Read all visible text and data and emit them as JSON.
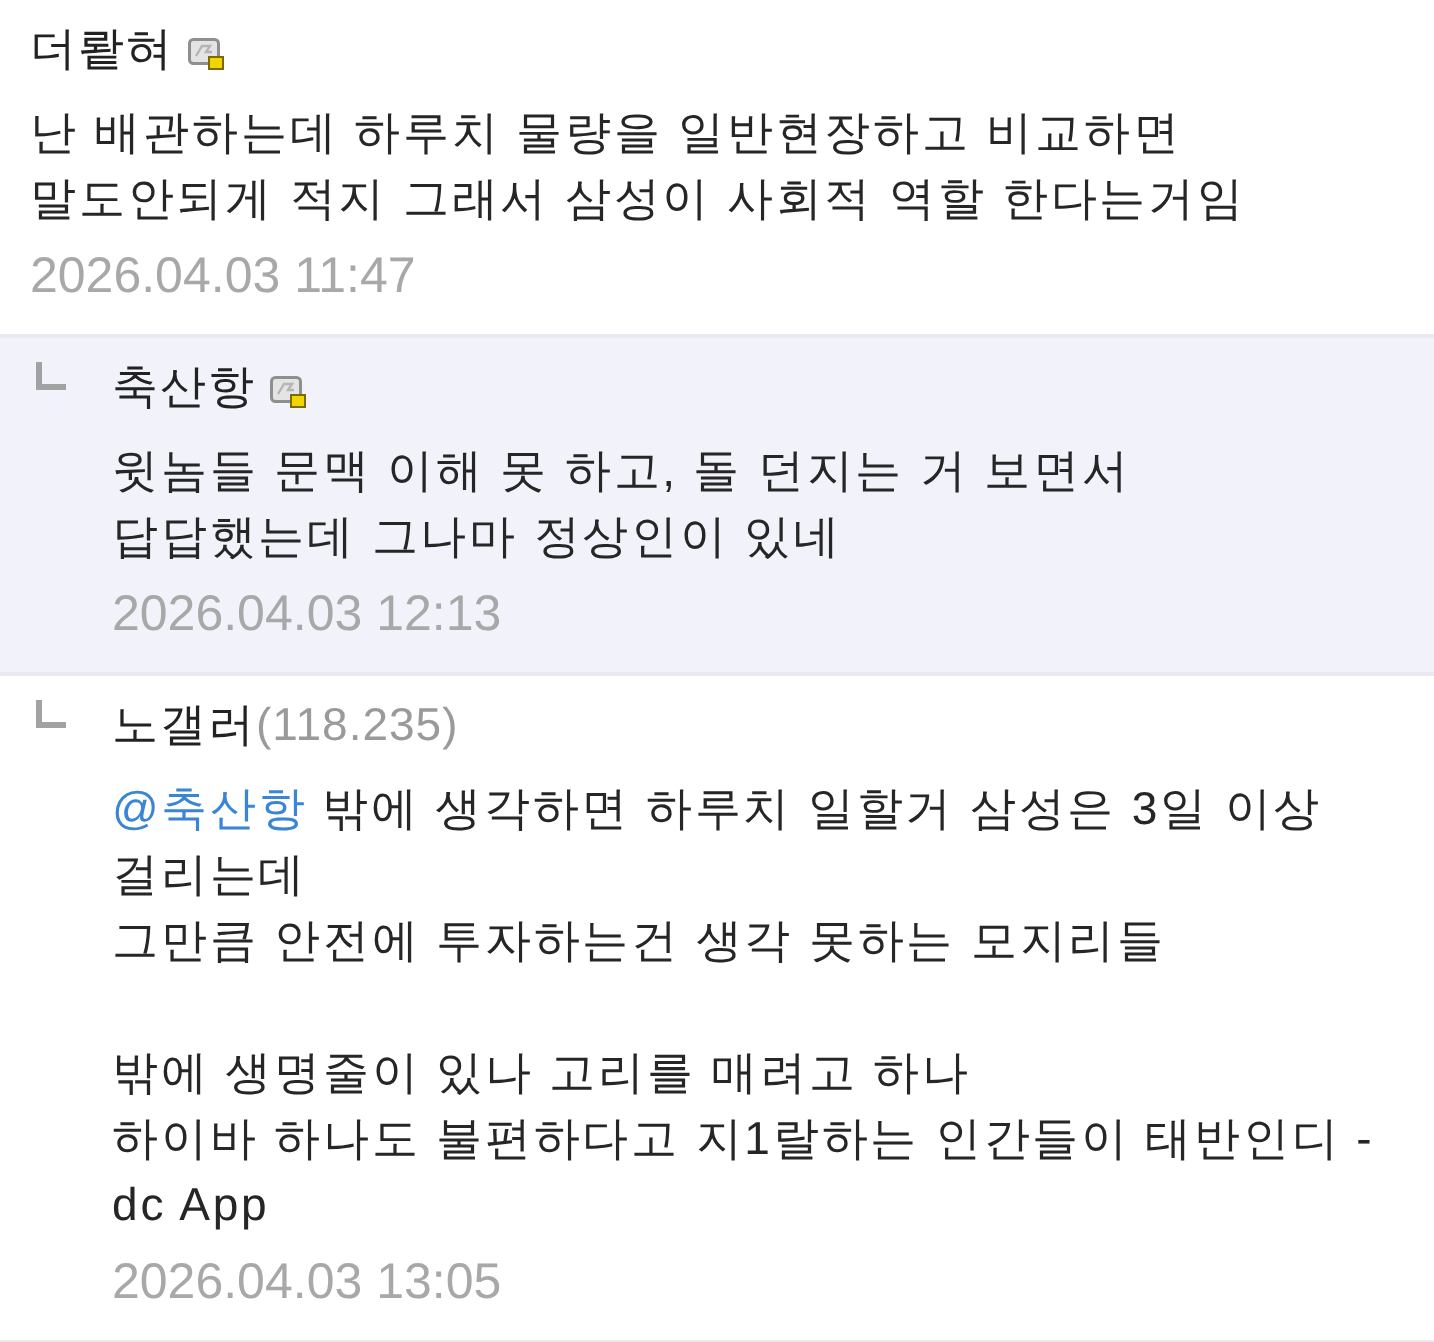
{
  "comments": [
    {
      "reply": false,
      "highlighted": false,
      "author": "더뢑혀",
      "kind": "member",
      "paragraphs": [
        {
          "lines": [
            "난 배관하는데 하루치 물량을 일반현장하고 비교하면",
            "말도안되게 적지 그래서 삼성이 사회적 역할 한다는거임"
          ]
        }
      ],
      "date": "2026.04.03 11:47"
    },
    {
      "reply": true,
      "highlighted": true,
      "author": "축산항",
      "kind": "member",
      "paragraphs": [
        {
          "lines": [
            "윗놈들 문맥 이해 못 하고, 돌 던지는 거 보면서",
            "답답했는데 그나마 정상인이 있네"
          ]
        }
      ],
      "date": "2026.04.03 12:13"
    },
    {
      "reply": true,
      "highlighted": false,
      "author": "노갤러",
      "kind": "guest",
      "ip": "(118.235)",
      "paragraphs": [
        {
          "mention": "@축산항",
          "lines": [
            "밖에 생각하면 하루치 일할거 삼성은 3일 이상",
            "걸리는데",
            "그만큼 안전에 투자하는건 생각 못하는 모지리들"
          ]
        },
        {
          "lines": [
            "밖에 생명줄이 있나 고리를 매려고 하나",
            "하이바 하나도 불편하다고 지1랄하는 인간들이 태반인디 -",
            "dc App"
          ]
        }
      ],
      "date": "2026.04.03 13:05"
    }
  ]
}
